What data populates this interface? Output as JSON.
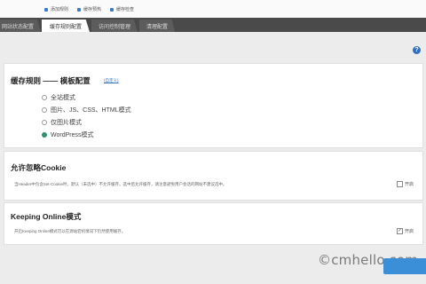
{
  "breadcrumbs": [
    "添加规则",
    "缓存预热",
    "缓存检查"
  ],
  "tabs": [
    "网站状态配置",
    "缓存规则配置",
    "访问控制管理",
    "清理配置"
  ],
  "help_icon_text": "?",
  "rule_section": {
    "title": "缓存规则 —— 模板配置",
    "edit_link": "(自定义)",
    "options": [
      "全站模式",
      "图片、JS、CSS、HTML模式",
      "仅图片模式",
      "WordPress模式"
    ],
    "selected_index": 3
  },
  "cookie_section": {
    "title": "允许忽略Cookie",
    "description": "当Header中包含Set-Cookie时，默认（未选中）不允许缓存，选中后允许缓存，请注意避免用户会话的网站不建议选中。",
    "toggle_label": "开启",
    "checked": false
  },
  "online_section": {
    "title": "Keeping Online模式",
    "description": "开启Keeping Online模式可以在源站宕机情况下仍然使用缓存。",
    "toggle_label": "开启",
    "checked": true
  },
  "watermark": "©cmhello.com",
  "colors": {
    "accent": "#2f6fbd",
    "tab_bar": "#4a4a4a",
    "save_button": "#3b8fd9"
  }
}
